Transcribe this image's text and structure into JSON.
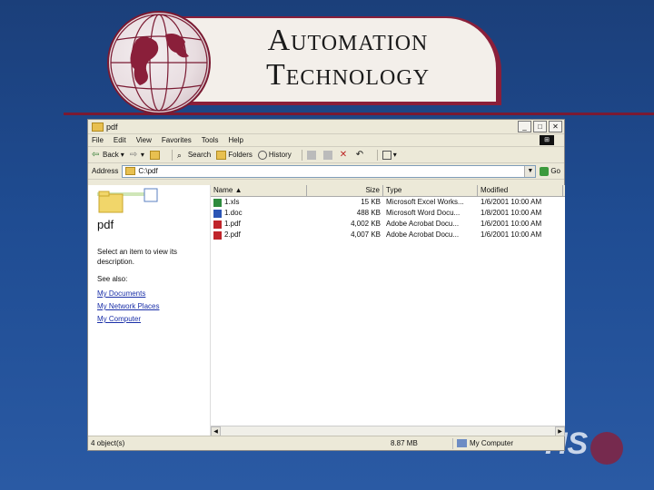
{
  "slide": {
    "title_line1": "Automation",
    "title_line2": "Technology",
    "logo_text": "HS",
    "colors": {
      "banner": "#8a1f3a",
      "background": "#1f4c92"
    }
  },
  "window": {
    "title": "pdf",
    "controls": [
      "_",
      "□",
      "✕"
    ],
    "menu": [
      "File",
      "Edit",
      "View",
      "Favorites",
      "Tools",
      "Help"
    ],
    "toolbar": {
      "back": "Back",
      "forward": "",
      "up": "",
      "search": "Search",
      "folders": "Folders",
      "history": "History"
    },
    "address": {
      "label": "Address",
      "value": "C:\\pdf",
      "go": "Go"
    },
    "left_pane": {
      "title": "pdf",
      "description": "Select an item to view its description.",
      "see_also": "See also:",
      "links": [
        "My Documents",
        "My Network Places",
        "My Computer"
      ]
    },
    "columns": {
      "name": "Name",
      "size": "Size",
      "type": "Type",
      "modified": "Modified"
    },
    "files": [
      {
        "name": "1.xls",
        "size": "15 KB",
        "type": "Microsoft Excel Works...",
        "modified": "1/6/2001 10:00 AM",
        "icon": "excel-icon"
      },
      {
        "name": "1.doc",
        "size": "488 KB",
        "type": "Microsoft Word Docu...",
        "modified": "1/8/2001 10:00 AM",
        "icon": "word-icon"
      },
      {
        "name": "1.pdf",
        "size": "4,002 KB",
        "type": "Adobe Acrobat Docu...",
        "modified": "1/6/2001 10:00 AM",
        "icon": "pdf-icon"
      },
      {
        "name": "2.pdf",
        "size": "4,007 KB",
        "type": "Adobe Acrobat Docu...",
        "modified": "1/6/2001 10:00 AM",
        "icon": "pdf-icon"
      }
    ],
    "status": {
      "objects": "4 object(s)",
      "size": "8.87 MB",
      "location": "My Computer"
    }
  }
}
